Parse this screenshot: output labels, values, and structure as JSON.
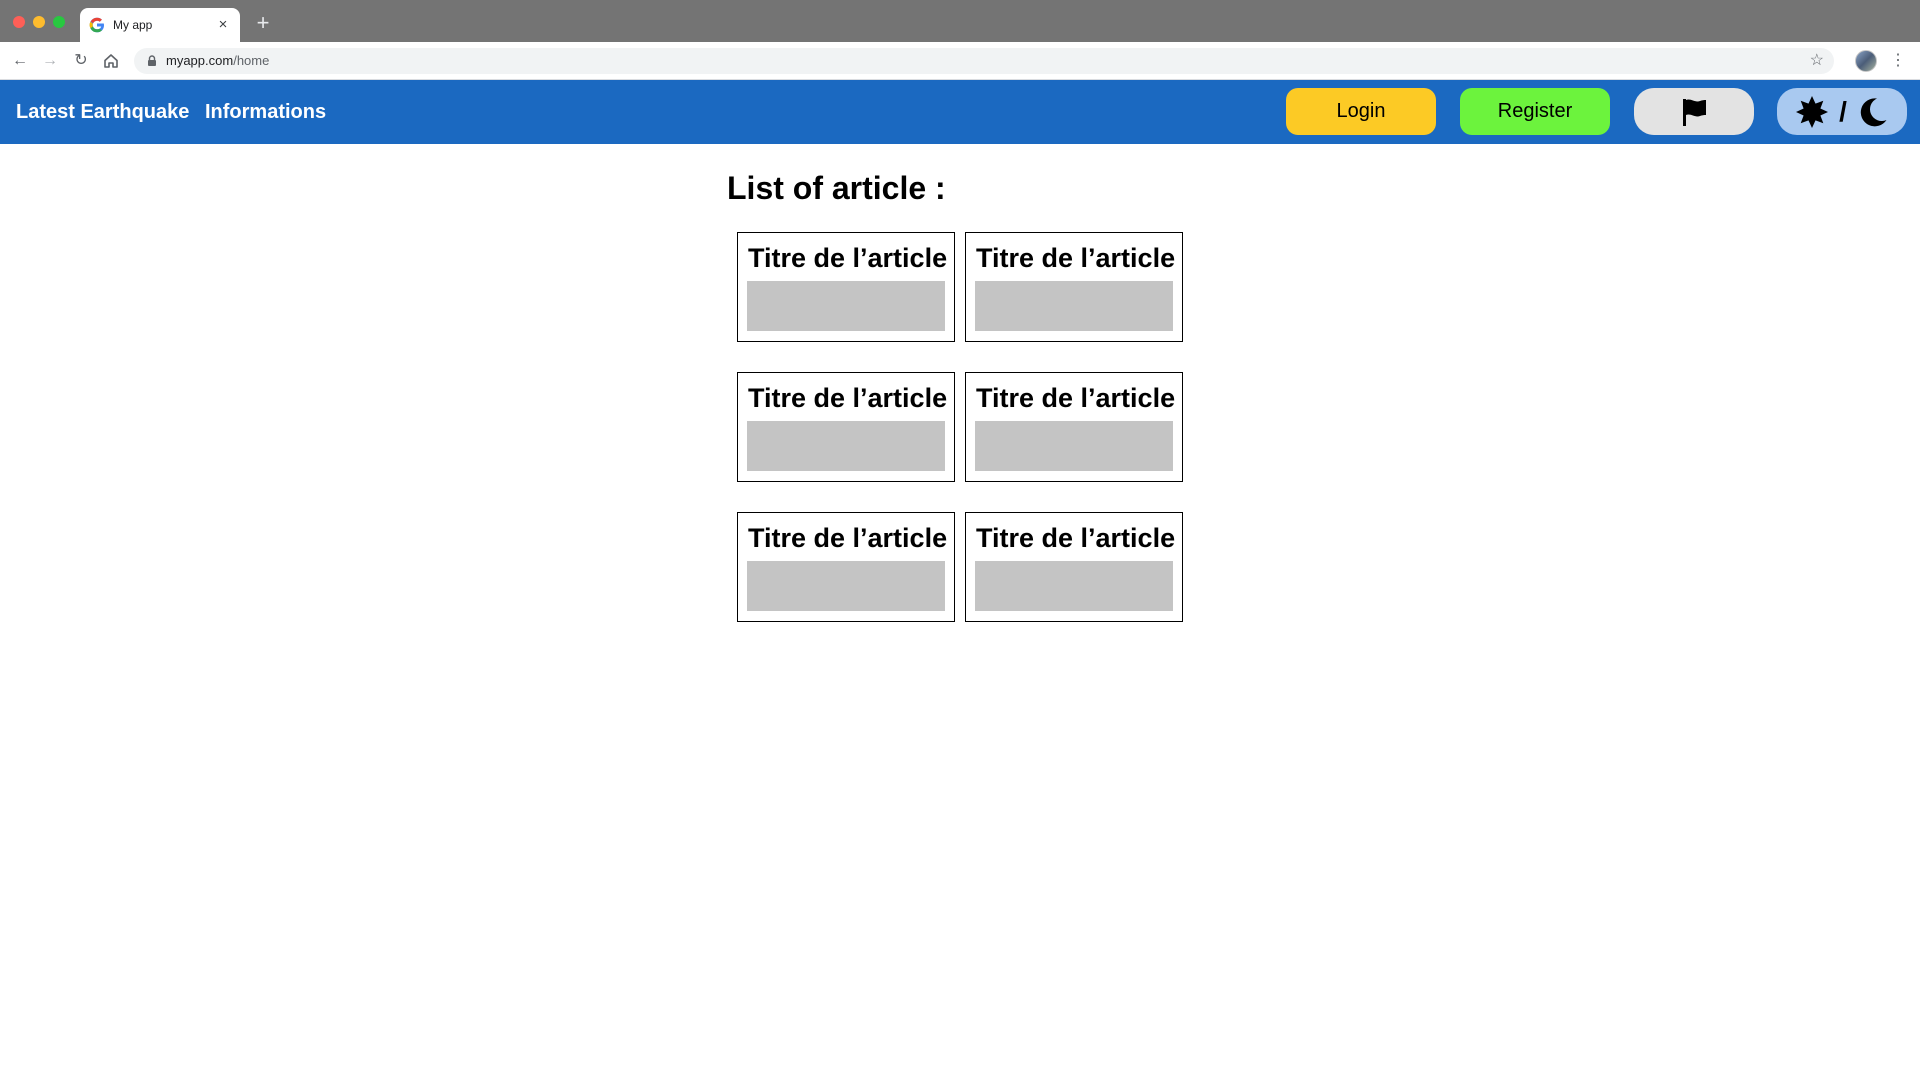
{
  "browser": {
    "tab_title": "My app",
    "tab_close": "×",
    "new_tab": "+",
    "url_host": "myapp.com",
    "url_path": "/home",
    "back": "←",
    "forward": "→",
    "reload": "↻",
    "star": "☆",
    "menu": "⋮",
    "icons": {
      "favicon": "google-favicon",
      "lock": "lock-icon",
      "home": "home-icon",
      "profile": "profile-avatar"
    }
  },
  "navbar": {
    "background": "#1b69c1",
    "links": [
      "Latest Earthquake",
      "Informations"
    ],
    "login_label": "Login",
    "register_label": "Register",
    "language_icon": "flag-icon",
    "theme_light_icon": "sun-icon",
    "theme_separator": "/",
    "theme_dark_icon": "moon-icon",
    "colors": {
      "login": "#fcca25",
      "register": "#6cf33d",
      "language": "#e3e3e3",
      "theme": "#a9c9f0"
    }
  },
  "main": {
    "heading": "List of article :",
    "articles": [
      {
        "title": "Titre de l’article"
      },
      {
        "title": "Titre de l’article"
      },
      {
        "title": "Titre de l’article"
      },
      {
        "title": "Titre de l’article"
      },
      {
        "title": "Titre de l’article"
      },
      {
        "title": "Titre de l’article"
      }
    ]
  }
}
